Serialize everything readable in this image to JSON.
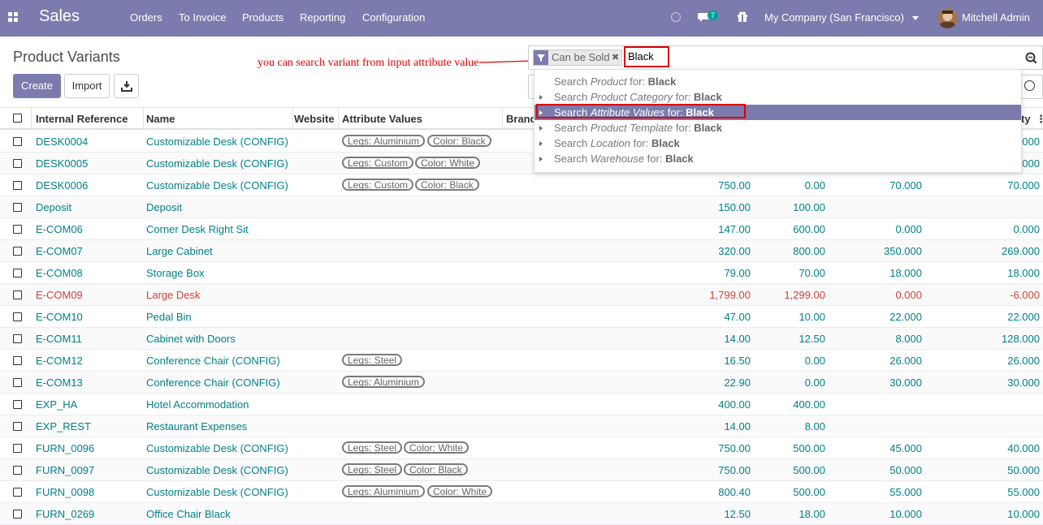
{
  "navbar": {
    "brand": "Sales",
    "menu": [
      "Orders",
      "To Invoice",
      "Products",
      "Reporting",
      "Configuration"
    ],
    "messages_badge": "7",
    "company": "My Company (San Francisco)",
    "user": "Mitchell Admin"
  },
  "page": {
    "title": "Product Variants",
    "create_label": "Create",
    "import_label": "Import"
  },
  "annotation": "you can search variant from input attribute value",
  "search": {
    "facet": "Can be Sold",
    "value": "Black",
    "suggestions": [
      {
        "prefix": "Search ",
        "field": "Product",
        "suffix": " for: ",
        "value": "Black"
      },
      {
        "prefix": "Search ",
        "field": "Product Category",
        "suffix": " for: ",
        "value": "Black"
      },
      {
        "prefix": "Search ",
        "field": "Attribute Values",
        "suffix": " for: ",
        "value": "Black"
      },
      {
        "prefix": "Search ",
        "field": "Product Template",
        "suffix": " for: ",
        "value": "Black"
      },
      {
        "prefix": "Search ",
        "field": "Location",
        "suffix": " for: ",
        "value": "Black"
      },
      {
        "prefix": "Search ",
        "field": "Warehouse",
        "suffix": " for: ",
        "value": "Black"
      }
    ]
  },
  "table": {
    "headers": {
      "ref": "Internal Reference",
      "name": "Name",
      "website": "Website",
      "attrs": "Attribute Values",
      "brand": "Brand",
      "qty": "ty"
    },
    "rows": [
      {
        "ref": "DESK0004",
        "name": "Customizable Desk (CONFIG)",
        "tags": [
          "Legs: Aluminium",
          "Color: Black"
        ],
        "c1": "",
        "c2": "",
        "c3": "",
        "c4": ".000"
      },
      {
        "ref": "DESK0005",
        "name": "Customizable Desk (CONFIG)",
        "tags": [
          "Legs: Custom",
          "Color: White"
        ],
        "c1": "",
        "c2": "",
        "c3": "",
        "c4": ".000"
      },
      {
        "ref": "DESK0006",
        "name": "Customizable Desk (CONFIG)",
        "tags": [
          "Legs: Custom",
          "Color: Black"
        ],
        "c1": "750.00",
        "c2": "0.00",
        "c3": "70.000",
        "c4": "70.000"
      },
      {
        "ref": "Deposit",
        "name": "Deposit",
        "tags": [],
        "c1": "150.00",
        "c2": "100.00",
        "c3": "",
        "c4": ""
      },
      {
        "ref": "E-COM06",
        "name": "Corner Desk Right Sit",
        "tags": [],
        "c1": "147.00",
        "c2": "600.00",
        "c3": "0.000",
        "c4": "0.000"
      },
      {
        "ref": "E-COM07",
        "name": "Large Cabinet",
        "tags": [],
        "c1": "320.00",
        "c2": "800.00",
        "c3": "350.000",
        "c4": "269.000"
      },
      {
        "ref": "E-COM08",
        "name": "Storage Box",
        "tags": [],
        "c1": "79.00",
        "c2": "70.00",
        "c3": "18.000",
        "c4": "18.000"
      },
      {
        "ref": "E-COM09",
        "name": "Large Desk",
        "tags": [],
        "c1": "1,799.00",
        "c2": "1,299.00",
        "c3": "0.000",
        "c4": "-6.000",
        "danger": true
      },
      {
        "ref": "E-COM10",
        "name": "Pedal Bin",
        "tags": [],
        "c1": "47.00",
        "c2": "10.00",
        "c3": "22.000",
        "c4": "22.000"
      },
      {
        "ref": "E-COM11",
        "name": "Cabinet with Doors",
        "tags": [],
        "c1": "14.00",
        "c2": "12.50",
        "c3": "8.000",
        "c4": "128.000"
      },
      {
        "ref": "E-COM12",
        "name": "Conference Chair (CONFIG)",
        "tags": [
          "Legs: Steel"
        ],
        "c1": "16.50",
        "c2": "0.00",
        "c3": "26.000",
        "c4": "26.000"
      },
      {
        "ref": "E-COM13",
        "name": "Conference Chair (CONFIG)",
        "tags": [
          "Legs: Aluminium"
        ],
        "c1": "22.90",
        "c2": "0.00",
        "c3": "30.000",
        "c4": "30.000"
      },
      {
        "ref": "EXP_HA",
        "name": "Hotel Accommodation",
        "tags": [],
        "c1": "400.00",
        "c2": "400.00",
        "c3": "",
        "c4": ""
      },
      {
        "ref": "EXP_REST",
        "name": "Restaurant Expenses",
        "tags": [],
        "c1": "14.00",
        "c2": "8.00",
        "c3": "",
        "c4": ""
      },
      {
        "ref": "FURN_0096",
        "name": "Customizable Desk (CONFIG)",
        "tags": [
          "Legs: Steel",
          "Color: White"
        ],
        "c1": "750.00",
        "c2": "500.00",
        "c3": "45.000",
        "c4": "40.000"
      },
      {
        "ref": "FURN_0097",
        "name": "Customizable Desk (CONFIG)",
        "tags": [
          "Legs: Steel",
          "Color: Black"
        ],
        "c1": "750.00",
        "c2": "500.00",
        "c3": "50.000",
        "c4": "50.000"
      },
      {
        "ref": "FURN_0098",
        "name": "Customizable Desk (CONFIG)",
        "tags": [
          "Legs: Aluminium",
          "Color: White"
        ],
        "c1": "800.40",
        "c2": "500.00",
        "c3": "55.000",
        "c4": "55.000"
      },
      {
        "ref": "FURN_0269",
        "name": "Office Chair Black",
        "tags": [],
        "c1": "12.50",
        "c2": "18.00",
        "c3": "10.000",
        "c4": "10.000"
      }
    ]
  }
}
